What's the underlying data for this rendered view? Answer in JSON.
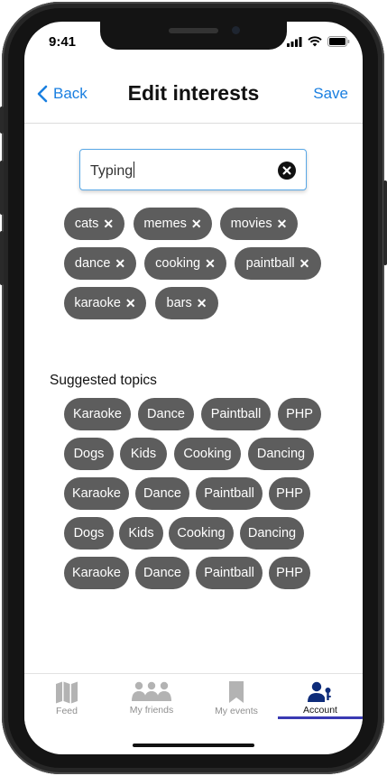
{
  "status": {
    "time": "9:41"
  },
  "nav": {
    "back_label": "Back",
    "title": "Edit interests",
    "save_label": "Save"
  },
  "search": {
    "value": "Typing"
  },
  "selected_tags": [
    "cats",
    "memes",
    "movies",
    "dance",
    "cooking",
    "paintball",
    "karaoke",
    "bars"
  ],
  "suggested": {
    "title": "Suggested topics",
    "topics": [
      "Karaoke",
      "Dance",
      "Paintball",
      "PHP",
      "Dogs",
      "Kids",
      "Cooking",
      "Dancing",
      "Karaoke",
      "Dance",
      "Paintball",
      "PHP",
      "Dogs",
      "Kids",
      "Cooking",
      "Dancing",
      "Karaoke",
      "Dance",
      "Paintball",
      "PHP"
    ]
  },
  "tabbar": {
    "active": "account",
    "items": [
      {
        "label": "Feed",
        "icon": "map-icon"
      },
      {
        "label": "My friends",
        "icon": "people-icon"
      },
      {
        "label": "My events",
        "icon": "bookmark-icon"
      },
      {
        "label": "Account",
        "icon": "account-icon"
      }
    ]
  },
  "colors": {
    "accent": "#1a7fe0",
    "chip": "#5d5d5d",
    "tab_active_underline": "#3a3ab3"
  }
}
